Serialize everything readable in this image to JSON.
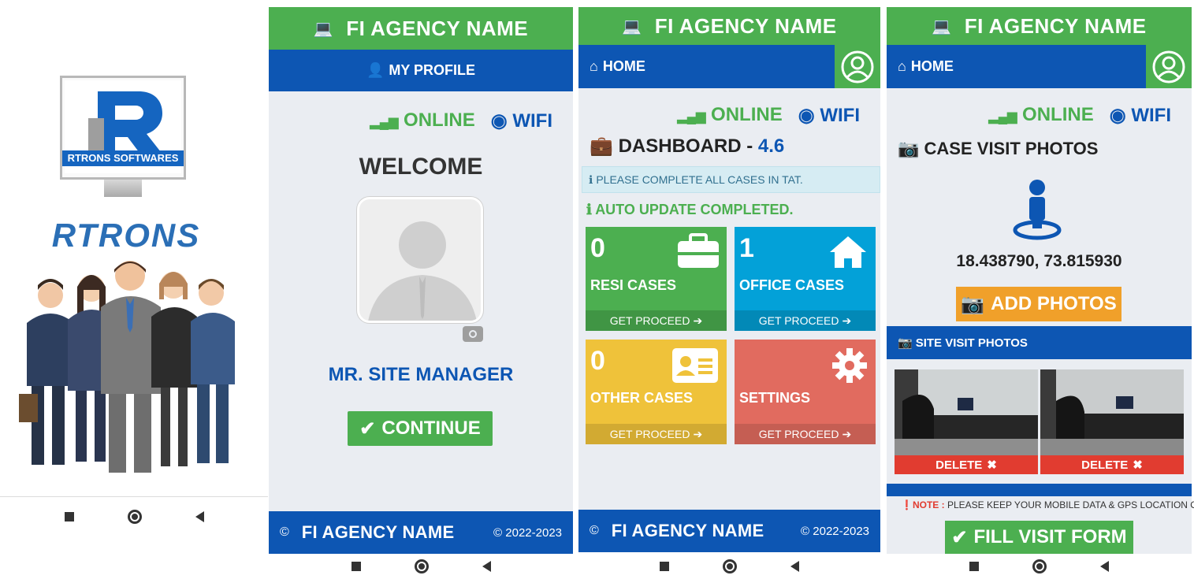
{
  "splash": {
    "brand_band": "RTRONS SOFTWARES",
    "brand_word": "RTRONS"
  },
  "app": {
    "agency": "FI AGENCY NAME",
    "year": "© 2022-2023",
    "copyright": "©",
    "online": "ONLINE",
    "wifi": "WIFI"
  },
  "profile": {
    "header": "MY PROFILE",
    "welcome": "WELCOME",
    "name": "MR. SITE MANAGER",
    "continue": "CONTINUE"
  },
  "home": {
    "header": "HOME",
    "dashboard_label": "DASHBOARD -",
    "version": "4.6",
    "alert": "PLEASE COMPLETE ALL CASES IN TAT.",
    "update": "AUTO UPDATE COMPLETED.",
    "tiles": [
      {
        "count": "0",
        "label": "RESI CASES",
        "link": "GET PROCEED"
      },
      {
        "count": "1",
        "label": "OFFICE CASES",
        "link": "GET PROCEED"
      },
      {
        "count": "0",
        "label": "OTHER CASES",
        "link": "GET PROCEED"
      },
      {
        "count": "",
        "label": "SETTINGS",
        "link": "GET PROCEED"
      }
    ]
  },
  "visit": {
    "header": "HOME",
    "title": "CASE VISIT PHOTOS",
    "coords": "18.438790, 73.815930",
    "add": "ADD PHOTOS",
    "site": "SITE VISIT PHOTOS",
    "delete": "DELETE",
    "note_label": "NOTE :",
    "note": "PLEASE KEEP YOUR MOBILE DATA & GPS LOCATION ON.",
    "fill": "FILL VISIT FORM"
  },
  "colors": {
    "green": "#4caf50",
    "blue": "#0d56b3",
    "cyan": "#03a1d8",
    "yellow": "#efc23a",
    "red": "#e16b5f",
    "orange": "#f0a02a"
  }
}
